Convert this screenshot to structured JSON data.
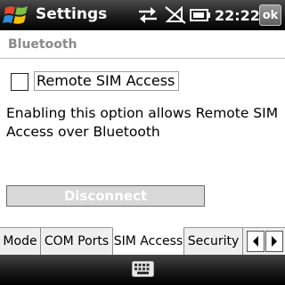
{
  "statusbar": {
    "title": "Settings",
    "time": "22:22",
    "ok_label": "ok",
    "icons": [
      "windows-start-icon",
      "sync-arrows-icon",
      "no-signal-icon",
      "battery-icon"
    ]
  },
  "page": {
    "title": "Bluetooth"
  },
  "content": {
    "checkbox_label": "Remote SIM Access",
    "checkbox_checked": false,
    "description": "Enabling this option allows Remote SIM Access over Bluetooth",
    "disconnect_label": "Disconnect",
    "disconnect_enabled": false
  },
  "tabs": [
    {
      "label": "Mode",
      "active": false
    },
    {
      "label": "COM Ports",
      "active": false
    },
    {
      "label": "SIM Access",
      "active": true
    },
    {
      "label": "Security",
      "active": false
    }
  ],
  "softbar": {
    "icon": "keyboard-icon"
  }
}
